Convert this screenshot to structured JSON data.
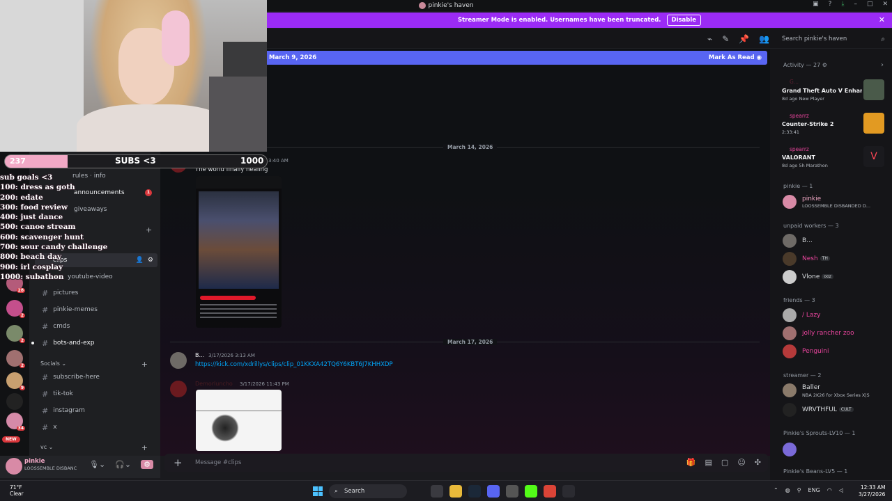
{
  "window": {
    "title": "pinkie's haven"
  },
  "banner": {
    "text": "Streamer Mode is enabled. Usernames have been truncated.",
    "button": "Disable"
  },
  "header": {
    "search_placeholder": "Search pinkie's haven"
  },
  "new_messages": {
    "date": "March 9, 2026",
    "mark_read": "Mark As Read"
  },
  "overlay": {
    "subs_count": "237",
    "subs_label": "SUBS <3",
    "subs_goal": "1000",
    "progress_fraction": 0.237,
    "goals": [
      "sub goals <3",
      "100: dress as goth",
      "200: edate",
      "300: food review",
      "400: just dance",
      "500: canoe stream",
      "600: scavenger hunt",
      "700: sour candy challenge",
      "800: beach day",
      "900: irl cosplay",
      "1000: subathon"
    ]
  },
  "channels": {
    "items": [
      {
        "name": "rules · info",
        "kind": "text"
      },
      {
        "name": "announcements",
        "kind": "text",
        "badge": "1"
      },
      {
        "name": "giveaways",
        "kind": "text"
      },
      {
        "name": "clips",
        "kind": "text"
      },
      {
        "name": "youtube-video",
        "kind": "text"
      },
      {
        "name": "pictures",
        "kind": "text"
      },
      {
        "name": "pinkie-memes",
        "kind": "text"
      },
      {
        "name": "cmds",
        "kind": "text"
      },
      {
        "name": "bots-and-exp",
        "kind": "text"
      }
    ],
    "socials_category": "Socials",
    "socials": [
      "subscribe-here",
      "tik-tok",
      "instagram",
      "x"
    ],
    "vc_category": "vc"
  },
  "guild_badges": [
    "28",
    "2",
    "2",
    "2",
    "9",
    "34"
  ],
  "guild_new": "NEW",
  "chat": {
    "date_1": "March 14, 2026",
    "msg_1": {
      "time": "3:40 AM",
      "text": "The world finally healing"
    },
    "date_2": "March 17, 2026",
    "msg_2": {
      "name": "B...",
      "time": "3/17/2026 3:13 AM",
      "link": "https://kick.com/xdrillys/clips/clip_01KKXA42TQ6Y6KBT6J7KHHXDP"
    },
    "msg_3": {
      "time": "3/17/2026 11:43 PM"
    }
  },
  "composer": {
    "placeholder": "Message #clips"
  },
  "user": {
    "name": "pinkie",
    "status": "LOOSSEMBLE DISBANC"
  },
  "members": {
    "activity_header": "Activity — 27",
    "activities": [
      {
        "user": "G...",
        "title": "Grand Theft Auto V Enhanc...",
        "sub": "8d ago  New Player"
      },
      {
        "user": "spearrz",
        "title": "Counter-Strike 2",
        "sub": "2:33:41"
      },
      {
        "user": "spearrz",
        "title": "VALORANT",
        "sub": "8d ago  5h Marathon"
      }
    ],
    "groups": [
      {
        "header": "pinkie — 1",
        "members": [
          {
            "name": "pinkie",
            "sub": "LOOSSEMBLE DISBANDED D..."
          }
        ]
      },
      {
        "header": "unpaid workers — 3",
        "members": [
          {
            "name": "B..."
          },
          {
            "name": "Nesh",
            "tag": "TH"
          },
          {
            "name": "Vlone",
            "tag": "ooz"
          }
        ]
      },
      {
        "header": "friends — 3",
        "members": [
          {
            "name": "/ Lazy"
          },
          {
            "name": "jolly rancher zoo"
          },
          {
            "name": "Penguini"
          }
        ]
      },
      {
        "header": "streamer — 2",
        "members": [
          {
            "name": "Baller",
            "sub": "NBA 2K26 for Xbox Series X|S"
          },
          {
            "name": "WRVTHFUL",
            "tag": "CULT"
          }
        ]
      },
      {
        "header": "Pinkie's Sprouts-LV10 — 1",
        "members": []
      },
      {
        "header": "Pinkie's Beans-LV5 — 1",
        "members": []
      }
    ]
  },
  "taskbar": {
    "weather_temp": "71°F",
    "weather_desc": "Clear",
    "search": "Search",
    "lang": "ENG",
    "time": "12:33 AM",
    "date": "3/27/2026"
  },
  "colors": {
    "accent": "#5865f2",
    "banner": "#9b2bf5",
    "mention": "#eb459e",
    "link": "#00a8fc"
  }
}
